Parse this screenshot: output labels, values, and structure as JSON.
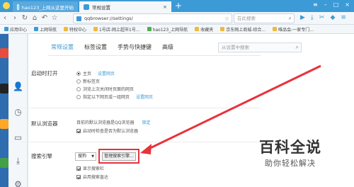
{
  "tabs": [
    {
      "title": "hao123_上网从这里开始"
    },
    {
      "title": "常规设置"
    }
  ],
  "toolbar": {
    "url": "qqbrowser://settings/",
    "search_placeholder": "在此搜索"
  },
  "bookmarks": [
    "应用中心",
    "上网导航",
    "特权中心",
    "1号店-网上超市1号...",
    "hao123_上网导航",
    "收藏夹",
    "京东网上商城-综合...",
    "唯品会-一家专门..."
  ],
  "settings": {
    "nav_tabs": [
      "常规设置",
      "标签设置",
      "手势与快捷键",
      "高级"
    ],
    "search_placeholder": "从设置中搜索",
    "startup": {
      "label": "启动时打开",
      "options": [
        "主页",
        "新标签页",
        "浏览上次关闭时页面的网页",
        "指定以下网页或一组网页"
      ],
      "set_homepage_link": "设置网页",
      "set_pages_link": "设置网页"
    },
    "default_browser": {
      "label": "默认浏览器",
      "status": "目前的默认浏览器是QQ浏览器",
      "lock_link": "锁定",
      "check_label": "启动时检查是否为默认浏览器"
    },
    "search_engine": {
      "label": "搜索引擎",
      "selected": "搜狗",
      "manage_button": "管理搜索引擎...",
      "opt1": "显示搜索栏",
      "opt2": "启用搜索直达"
    }
  },
  "watermark": {
    "title": "百科全说",
    "subtitle": "助你轻松解决"
  },
  "colors": {
    "brand": "#3c9ad6",
    "highlight": "#e8323c"
  }
}
